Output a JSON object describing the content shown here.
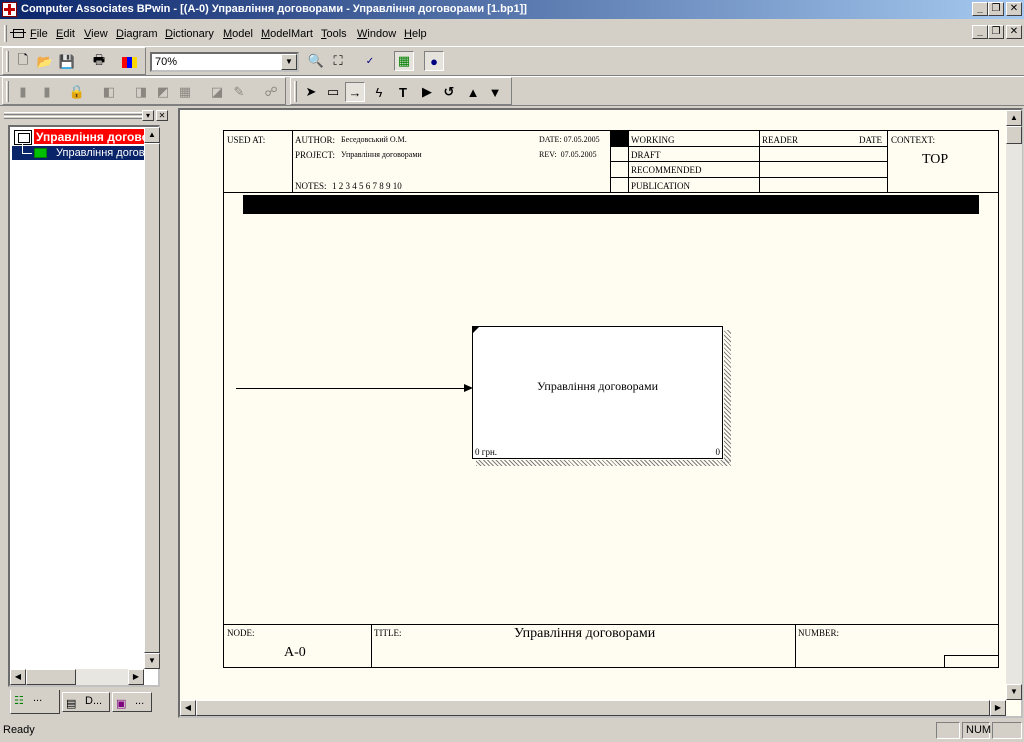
{
  "window": {
    "title": "Computer Associates BPwin - [(A-0) Управління договорами - Управління договорами  [1.bp1]]"
  },
  "menu": {
    "items": [
      "File",
      "Edit",
      "View",
      "Diagram",
      "Dictionary",
      "Model",
      "ModelMart",
      "Tools",
      "Window",
      "Help"
    ]
  },
  "toolbar": {
    "zoom_value": "70%"
  },
  "tree": {
    "root_label": "Управління договорами",
    "child_label": "Управління договорами"
  },
  "tabs": {
    "activities": "...",
    "diagrams": "D...",
    "objects": "..."
  },
  "diagram": {
    "header": {
      "used_at_label": "USED AT:",
      "author_label": "AUTHOR:",
      "author_value": "Беседовський О.М.",
      "project_label": "PROJECT:",
      "project_value": "Управління договорами",
      "notes_label": "NOTES:",
      "notes_value": "1 2 3 4 5 6 7 8 9 10",
      "date_label": "DATE:",
      "date_value": "07.05.2005",
      "rev_label": "REV:",
      "rev_value": "07.05.2005",
      "status": [
        "WORKING",
        "DRAFT",
        "RECOMMENDED",
        "PUBLICATION"
      ],
      "reader_label": "READER",
      "reader_date_label": "DATE",
      "context_label": "CONTEXT:",
      "context_value": "TOP"
    },
    "activity": {
      "name": "Управління договорами",
      "cost": "0 грн.",
      "number": "0"
    },
    "footer": {
      "node_label": "NODE:",
      "node_value": "A-0",
      "title_label": "TITLE:",
      "title_value": "Управління договорами",
      "number_label": "NUMBER:"
    }
  },
  "status": {
    "text": "Ready",
    "num": "NUM"
  }
}
